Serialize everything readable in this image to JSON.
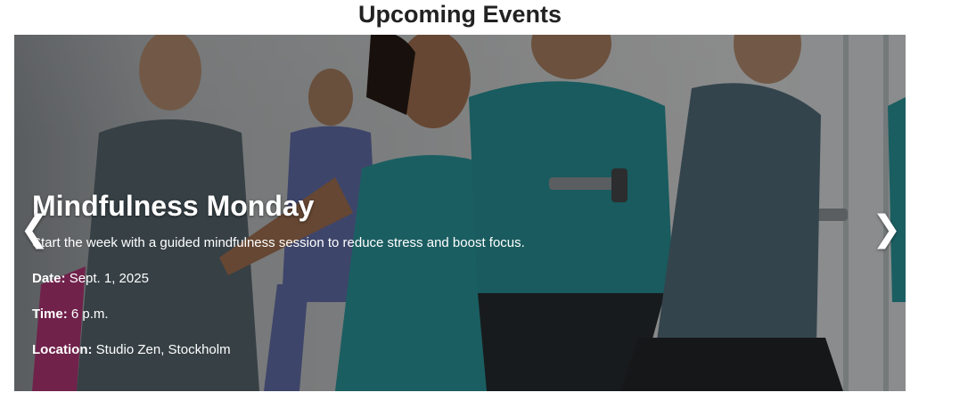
{
  "section": {
    "title": "Upcoming Events"
  },
  "carousel": {
    "prev_icon": "❮",
    "next_icon": "❯",
    "overlay_color": "#000000",
    "slide": {
      "title": "Mindfulness Monday",
      "description": "Start the week with a guided mindfulness session to reduce stress and boost focus.",
      "date_label": "Date:",
      "date_value": "Sept. 1, 2025",
      "time_label": "Time:",
      "time_value": "6 p.m.",
      "location_label": "Location:",
      "location_value": "Studio Zen, Stockholm"
    }
  },
  "colors": {
    "accent_teal": "#2fa3a8",
    "text_dark": "#222222"
  }
}
